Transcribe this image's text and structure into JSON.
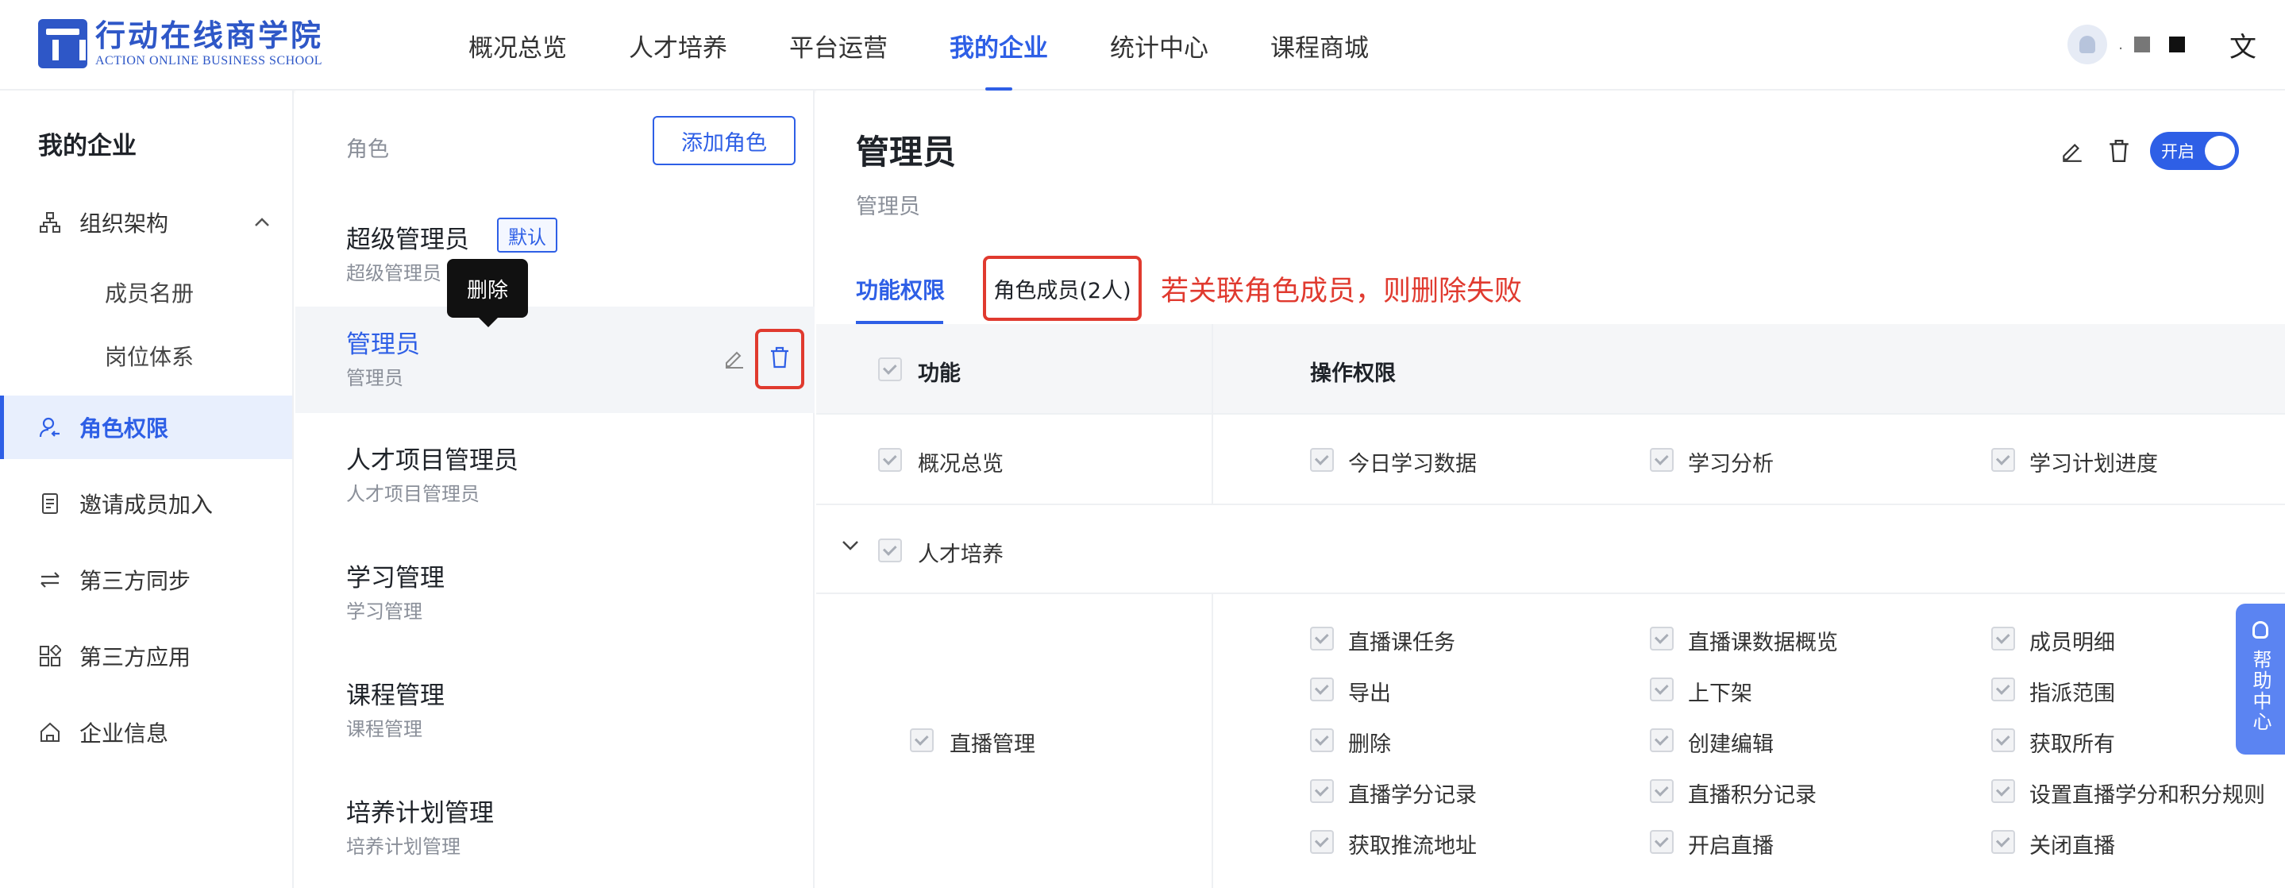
{
  "brand": {
    "name_cn": "行动在线商学院",
    "name_en": "ACTION ONLINE BUSINESS SCHOOL"
  },
  "nav": {
    "items": [
      "概况总览",
      "人才培养",
      "平台运营",
      "我的企业",
      "统计中心",
      "课程商城"
    ],
    "active": "我的企业"
  },
  "user": {
    "name_mask": "."
  },
  "sidebar": {
    "title": "我的企业",
    "items": [
      {
        "label": "组织架构",
        "icon": "org-chart-icon"
      },
      {
        "label": "成员名册"
      },
      {
        "label": "岗位体系"
      },
      {
        "label": "角色权限",
        "icon": "user-permission-icon"
      },
      {
        "label": "邀请成员加入",
        "icon": "invite-icon"
      },
      {
        "label": "第三方同步",
        "icon": "sync-icon"
      },
      {
        "label": "第三方应用",
        "icon": "apps-icon"
      },
      {
        "label": "企业信息",
        "icon": "home-icon"
      }
    ]
  },
  "roles": {
    "header": "角色",
    "add_button": "添加角色",
    "default_badge": "默认",
    "tooltip": "删除",
    "list": [
      {
        "name": "超级管理员",
        "desc": "超级管理员"
      },
      {
        "name": "管理员",
        "desc": "管理员"
      },
      {
        "name": "人才项目管理员",
        "desc": "人才项目管理员"
      },
      {
        "name": "学习管理",
        "desc": "学习管理"
      },
      {
        "name": "课程管理",
        "desc": "课程管理"
      },
      {
        "name": "培养计划管理",
        "desc": "培养计划管理"
      }
    ]
  },
  "detail": {
    "title": "管理员",
    "subtitle": "管理员",
    "toggle_label": "开启",
    "tabs": [
      "功能权限",
      "角色成员(2人)"
    ],
    "annotation": "若关联角色成员，则删除失败"
  },
  "permissions": {
    "col_function": "功能",
    "col_actions": "操作权限",
    "overview": {
      "name": "概况总览",
      "actions": [
        "今日学习数据",
        "学习分析",
        "学习计划进度"
      ]
    },
    "talent": {
      "name": "人才培养"
    },
    "live": {
      "name": "直播管理",
      "actions": [
        [
          "直播课任务",
          "直播课数据概览",
          "成员明细"
        ],
        [
          "导出",
          "上下架",
          "指派范围"
        ],
        [
          "删除",
          "创建编辑",
          "获取所有"
        ],
        [
          "直播学分记录",
          "直播积分记录",
          "设置直播学分和积分规则"
        ],
        [
          "获取推流地址",
          "开启直播",
          "关闭直播"
        ]
      ]
    }
  },
  "help": {
    "label": "帮助中心"
  },
  "colors": {
    "accent": "#2e5fe6",
    "danger": "#e03a2f"
  }
}
